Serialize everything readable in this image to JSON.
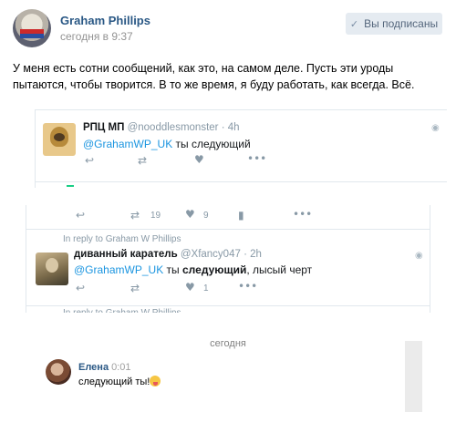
{
  "post": {
    "author": "Graham Phillips",
    "time": "сегодня в 9:37",
    "subscribe_label": "Вы подписаны",
    "subscribe_icon": "check-icon",
    "text": "У меня есть сотни сообщений, как это, на самом деле. Пусть эти уроды пытаются, чтобы творится. В то же время, я буду работать, как всегда. Всё."
  },
  "tweet1": {
    "name": "РПЦ МП",
    "handle": "@nooddlesmonster",
    "time": "· 4h",
    "mention": "@GrahamWP_UK",
    "text": " ты следующий",
    "icons": [
      "reply-icon",
      "retweet-icon",
      "like-icon",
      "more-icon"
    ]
  },
  "tweet2": {
    "retweet_count": "19",
    "like_count": "9",
    "reply_note": "In reply to Graham W Phillips",
    "name": "диванный каратель",
    "handle": "@Xfancy047",
    "time": "· 2h",
    "mention": "@GrahamWP_UK",
    "text_plain": " ты ",
    "text_bold": "следующий",
    "text_end": ", лысый черт",
    "like_count2": "1",
    "reply_note2": "In reply to Graham W Phillips"
  },
  "chat": {
    "date": "сегодня",
    "name": "Елена",
    "time": "0:01",
    "text": "следующий ты!"
  },
  "colors": {
    "link": "#2a5885",
    "twitter_blue": "#1b95e0",
    "muted": "#8899a6"
  }
}
